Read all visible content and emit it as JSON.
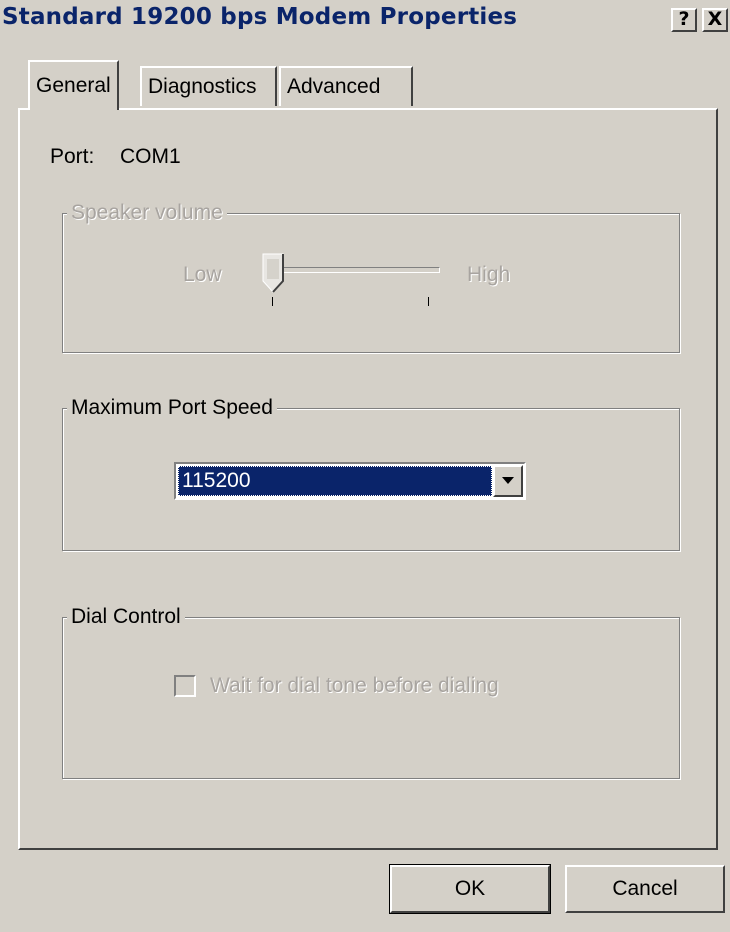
{
  "window": {
    "title": "Standard 19200 bps Modem Properties",
    "help_button": "?",
    "close_button": "X"
  },
  "tabs": [
    {
      "label": "General",
      "selected": true
    },
    {
      "label": "Diagnostics",
      "selected": false
    },
    {
      "label": "Advanced",
      "selected": false
    }
  ],
  "general": {
    "port_label": "Port:",
    "port_value": "COM1",
    "speaker_volume": {
      "label": "Speaker volume",
      "low_label": "Low",
      "high_label": "High",
      "level": 0,
      "enabled": false
    },
    "max_port_speed": {
      "label": "Maximum Port Speed",
      "selected_value": "115200"
    },
    "dial_control": {
      "label": "Dial Control",
      "checkbox_label": "Wait for dial tone before dialing",
      "checked": false,
      "enabled": false
    }
  },
  "buttons": {
    "ok": "OK",
    "cancel": "Cancel"
  },
  "colors": {
    "face": "#d4d0c8",
    "title_text": "#0a246a",
    "selection": "#0a246a",
    "disabled_text": "#a8a4a0"
  }
}
